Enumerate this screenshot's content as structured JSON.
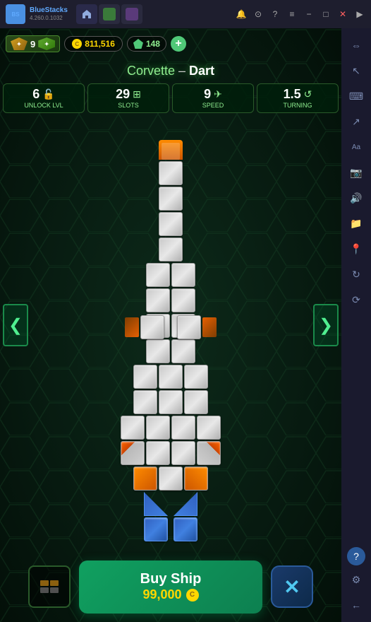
{
  "bluestacks": {
    "logo": "BS",
    "version": "4.260.0.1032",
    "tabs": [
      "Ho",
      "Sp"
    ]
  },
  "topbar": {
    "player_level": "9",
    "coins": "811,516",
    "gems": "148",
    "add_label": "+"
  },
  "ship": {
    "class": "Corvette",
    "dash": "–",
    "name": "Dart",
    "title": "Corvette – Dart"
  },
  "stats": [
    {
      "id": "unlock",
      "value": "6",
      "label": "Unlock lvl",
      "icon": "🔓"
    },
    {
      "id": "slots",
      "value": "29",
      "label": "Slots",
      "icon": "⊞"
    },
    {
      "id": "speed",
      "value": "9",
      "label": "Speed",
      "icon": "✈"
    },
    {
      "id": "turning",
      "value": "1.5",
      "label": "Turning",
      "icon": "↺"
    }
  ],
  "nav": {
    "left": "❮",
    "right": "❯"
  },
  "buy": {
    "label": "Buy Ship",
    "price": "99,000",
    "coin_symbol": "C"
  },
  "close": {
    "label": "✕"
  },
  "sidebar_icons": [
    "↕",
    "⌨",
    "↗",
    "Aa",
    "📷",
    "🔊",
    "📁",
    "📍",
    "🔄",
    "⟳",
    "↩",
    "?",
    "⚙",
    "←"
  ]
}
